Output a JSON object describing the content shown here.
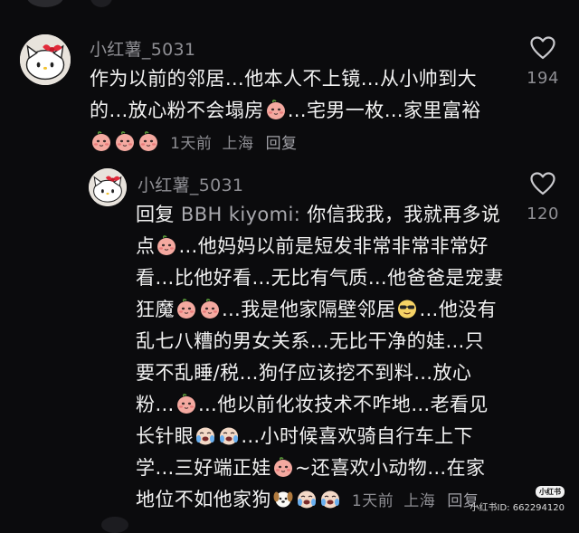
{
  "comments": [
    {
      "username": "小红薯_5031",
      "line1": "作为以前的邻居…他本人不上镜…从小帅到大",
      "line2a": "的…放心粉不会塌房",
      "line2b": "…宅男一枚…家里富裕",
      "time": "1天前",
      "location": "上海",
      "reply_label": "回复",
      "likes": "194"
    },
    {
      "username": "小红薯_5031",
      "reply_prefix": "回复",
      "mention": "BBH kiyomi:",
      "l1a": " 你信我我，我就再多说",
      "l2a": "点",
      "l2b": "…他妈妈以前是短发非常非常非常好",
      "l3": "看…比他好看…无比有气质…他爸爸是宠妻",
      "l4a": "狂魔",
      "l4b": "…我是他家隔壁邻居",
      "l4c": "…他没有",
      "l5": "乱七八糟的男女关系…无比干净的娃…只",
      "l6": "要不乱睡/税…狗仔应该挖不到料…放心",
      "l7a": "粉…",
      "l7b": "…他以前化妆技术不咋地…老看见",
      "l8a": "长针眼",
      "l8b": "…小时候喜欢骑自行车上下",
      "l9a": "学…三好端正娃",
      "l9b": "~还喜欢小动物…在家",
      "l10a": "地位不如他家狗",
      "time": "1天前",
      "location": "上海",
      "reply_label": "回复",
      "likes": "120"
    }
  ],
  "watermark": {
    "logo": "小红书",
    "id": "小红书ID: 662294120"
  },
  "icons": {
    "emoji_peach": "peach-blush-emoji-icon",
    "emoji_cry": "crying-laugh-emoji-icon",
    "emoji_dog": "dog-emoji-icon",
    "emoji_cool": "cool-face-emoji-icon",
    "like": "heart-outline-icon"
  },
  "colors": {
    "background": "#0b0b0d",
    "text": "#f2f2f2",
    "muted": "#8e8e93",
    "peach": "#f4a9a0"
  }
}
